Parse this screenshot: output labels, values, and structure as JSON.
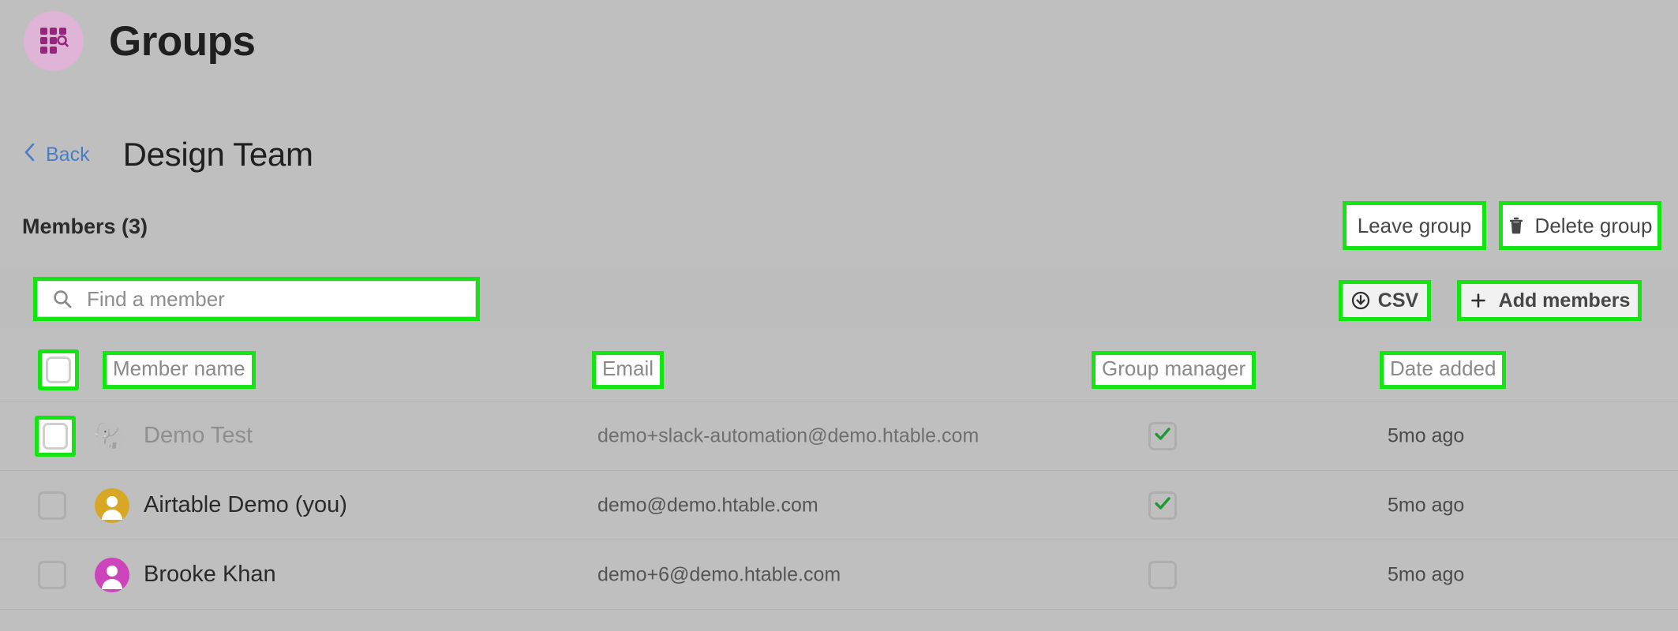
{
  "app": {
    "title": "Groups",
    "logo_icon": "groups-grid-search-icon",
    "logo_bg": "#e0b4d7",
    "logo_fg": "#99247f"
  },
  "breadcrumb": {
    "back_label": "Back",
    "back_icon": "chevron-left-icon",
    "back_color": "#4a7ec4",
    "group_title": "Design Team"
  },
  "members_bar": {
    "label": "Members (3)",
    "leave_group_label": "Leave group",
    "delete_group_label": "Delete group",
    "delete_group_icon": "trash-icon"
  },
  "toolbar": {
    "search_placeholder": "Find a member",
    "search_value": "",
    "search_icon": "search-icon",
    "csv_label": "CSV",
    "csv_icon": "download-circle-icon",
    "add_members_label": "Add members",
    "add_members_icon": "plus-icon"
  },
  "table": {
    "columns": [
      {
        "key": "select",
        "label": ""
      },
      {
        "key": "name",
        "label": "Member name"
      },
      {
        "key": "email",
        "label": "Email"
      },
      {
        "key": "manager",
        "label": "Group manager"
      },
      {
        "key": "date",
        "label": "Date added"
      }
    ],
    "select_all_checked": false,
    "rows": [
      {
        "name": "Demo Test",
        "email": "demo+slack-automation@demo.htable.com",
        "manager": true,
        "date": "5mo ago",
        "selected": false,
        "avatar_type": "emoji",
        "avatar_glyph": "🐘",
        "avatar_color": "#9a9a9a",
        "dimmed": true
      },
      {
        "name": "Airtable Demo (you)",
        "email": "demo@demo.htable.com",
        "manager": true,
        "date": "5mo ago",
        "selected": false,
        "avatar_type": "person",
        "avatar_glyph": "",
        "avatar_color": "#d9a726",
        "dimmed": false
      },
      {
        "name": "Brooke Khan",
        "email": "demo+6@demo.htable.com",
        "manager": false,
        "date": "5mo ago",
        "selected": false,
        "avatar_type": "person",
        "avatar_glyph": "",
        "avatar_color": "#cd43bc",
        "dimmed": false
      }
    ]
  },
  "annotations": {
    "highlight_color": "#12e512",
    "check_color": "#1d9b33"
  }
}
